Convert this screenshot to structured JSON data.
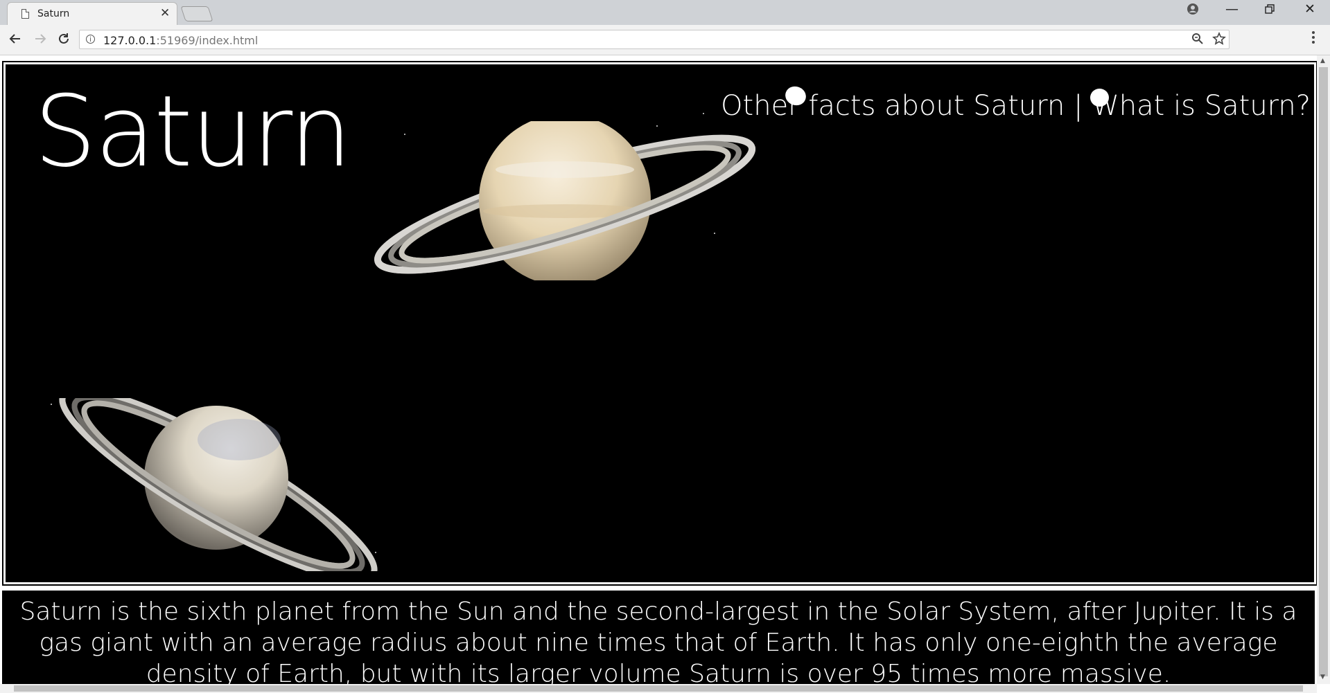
{
  "browser": {
    "tab_title": "Saturn",
    "tab_close": "✕",
    "url_host": "127.0.0.1",
    "url_rest": ":51969/index.html",
    "back_icon": "back-arrow-icon",
    "forward_icon": "forward-arrow-icon",
    "reload_icon": "reload-icon",
    "zoom_icon": "zoom-icon",
    "bookmark_icon": "star-icon",
    "menu_icon": "kebab-menu-icon"
  },
  "page": {
    "brand": "Saturn",
    "nav": {
      "link1": "Other facts about Saturn",
      "separator": "|",
      "link2": "What is Saturn?"
    },
    "description": "Saturn is the sixth planet from the Sun and the second-largest in the Solar System, after Jupiter. It is a gas giant with an average radius about nine times that of Earth. It has only one-eighth the average density of Earth, but with its larger volume Saturn is over 95 times more massive."
  }
}
